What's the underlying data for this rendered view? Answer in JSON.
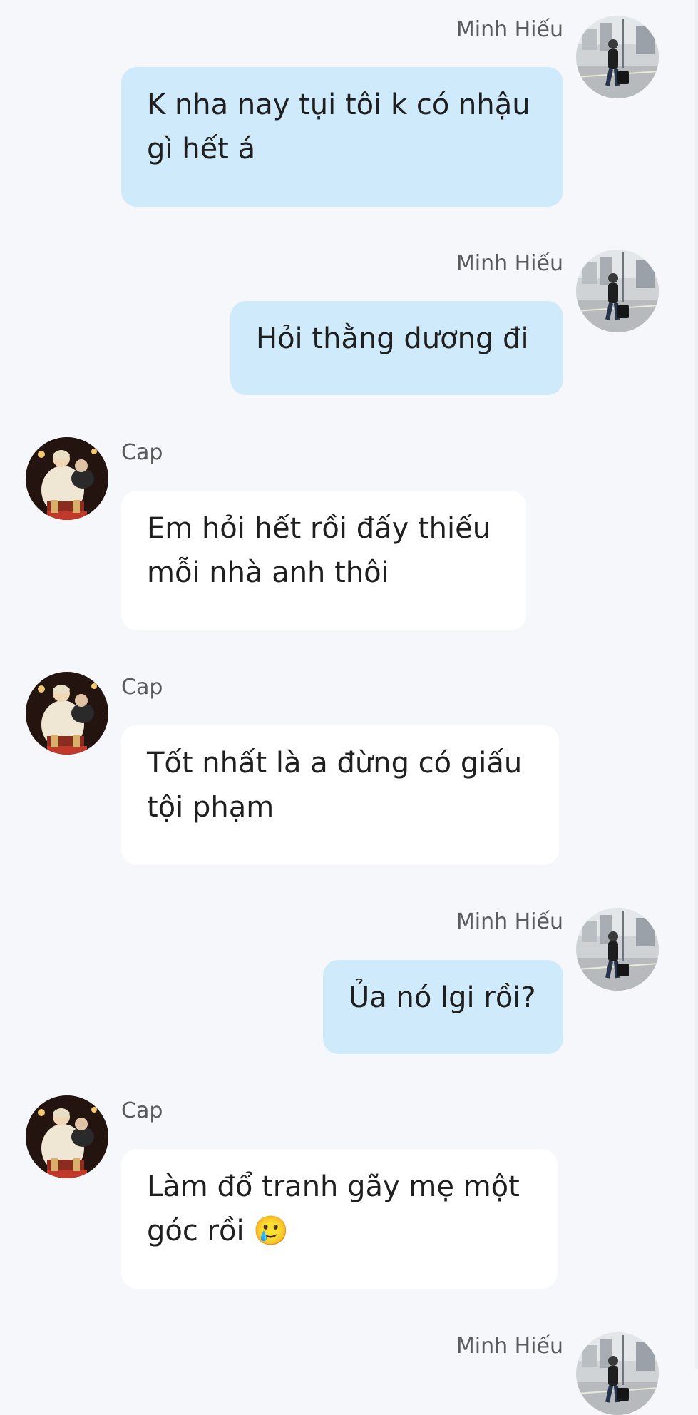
{
  "conversation": {
    "messages": [
      {
        "sender": "Minh Hiếu",
        "text": "K nha nay tụi tôi k có nhậu gì hết á",
        "side": "right"
      },
      {
        "sender": "Minh Hiếu",
        "text": "Hỏi thằng dương đi",
        "side": "right"
      },
      {
        "sender": "Cap",
        "text": "Em hỏi hết rồi đấy thiếu mỗi nhà anh thôi",
        "side": "left"
      },
      {
        "sender": "Cap",
        "text": "Tốt nhất là a đừng có giấu tội phạm",
        "side": "left"
      },
      {
        "sender": "Minh Hiếu",
        "text": "Ủa nó lgi rồi?",
        "side": "right"
      },
      {
        "sender": "Cap",
        "text": "Làm đổ tranh gãy mẹ một góc rồi 🥲",
        "side": "left"
      },
      {
        "sender": "Minh Hiếu",
        "text": "",
        "side": "right"
      }
    ]
  },
  "colors": {
    "background": "#f5f7fa",
    "own_bubble": "#cfeafb",
    "other_bubble": "#ffffff",
    "sender_name": "#5b5b5b",
    "message_text": "#1f1f1f"
  },
  "icons": {
    "own_avatar": "avatar-minh-hieu",
    "other_avatar": "avatar-cap"
  }
}
